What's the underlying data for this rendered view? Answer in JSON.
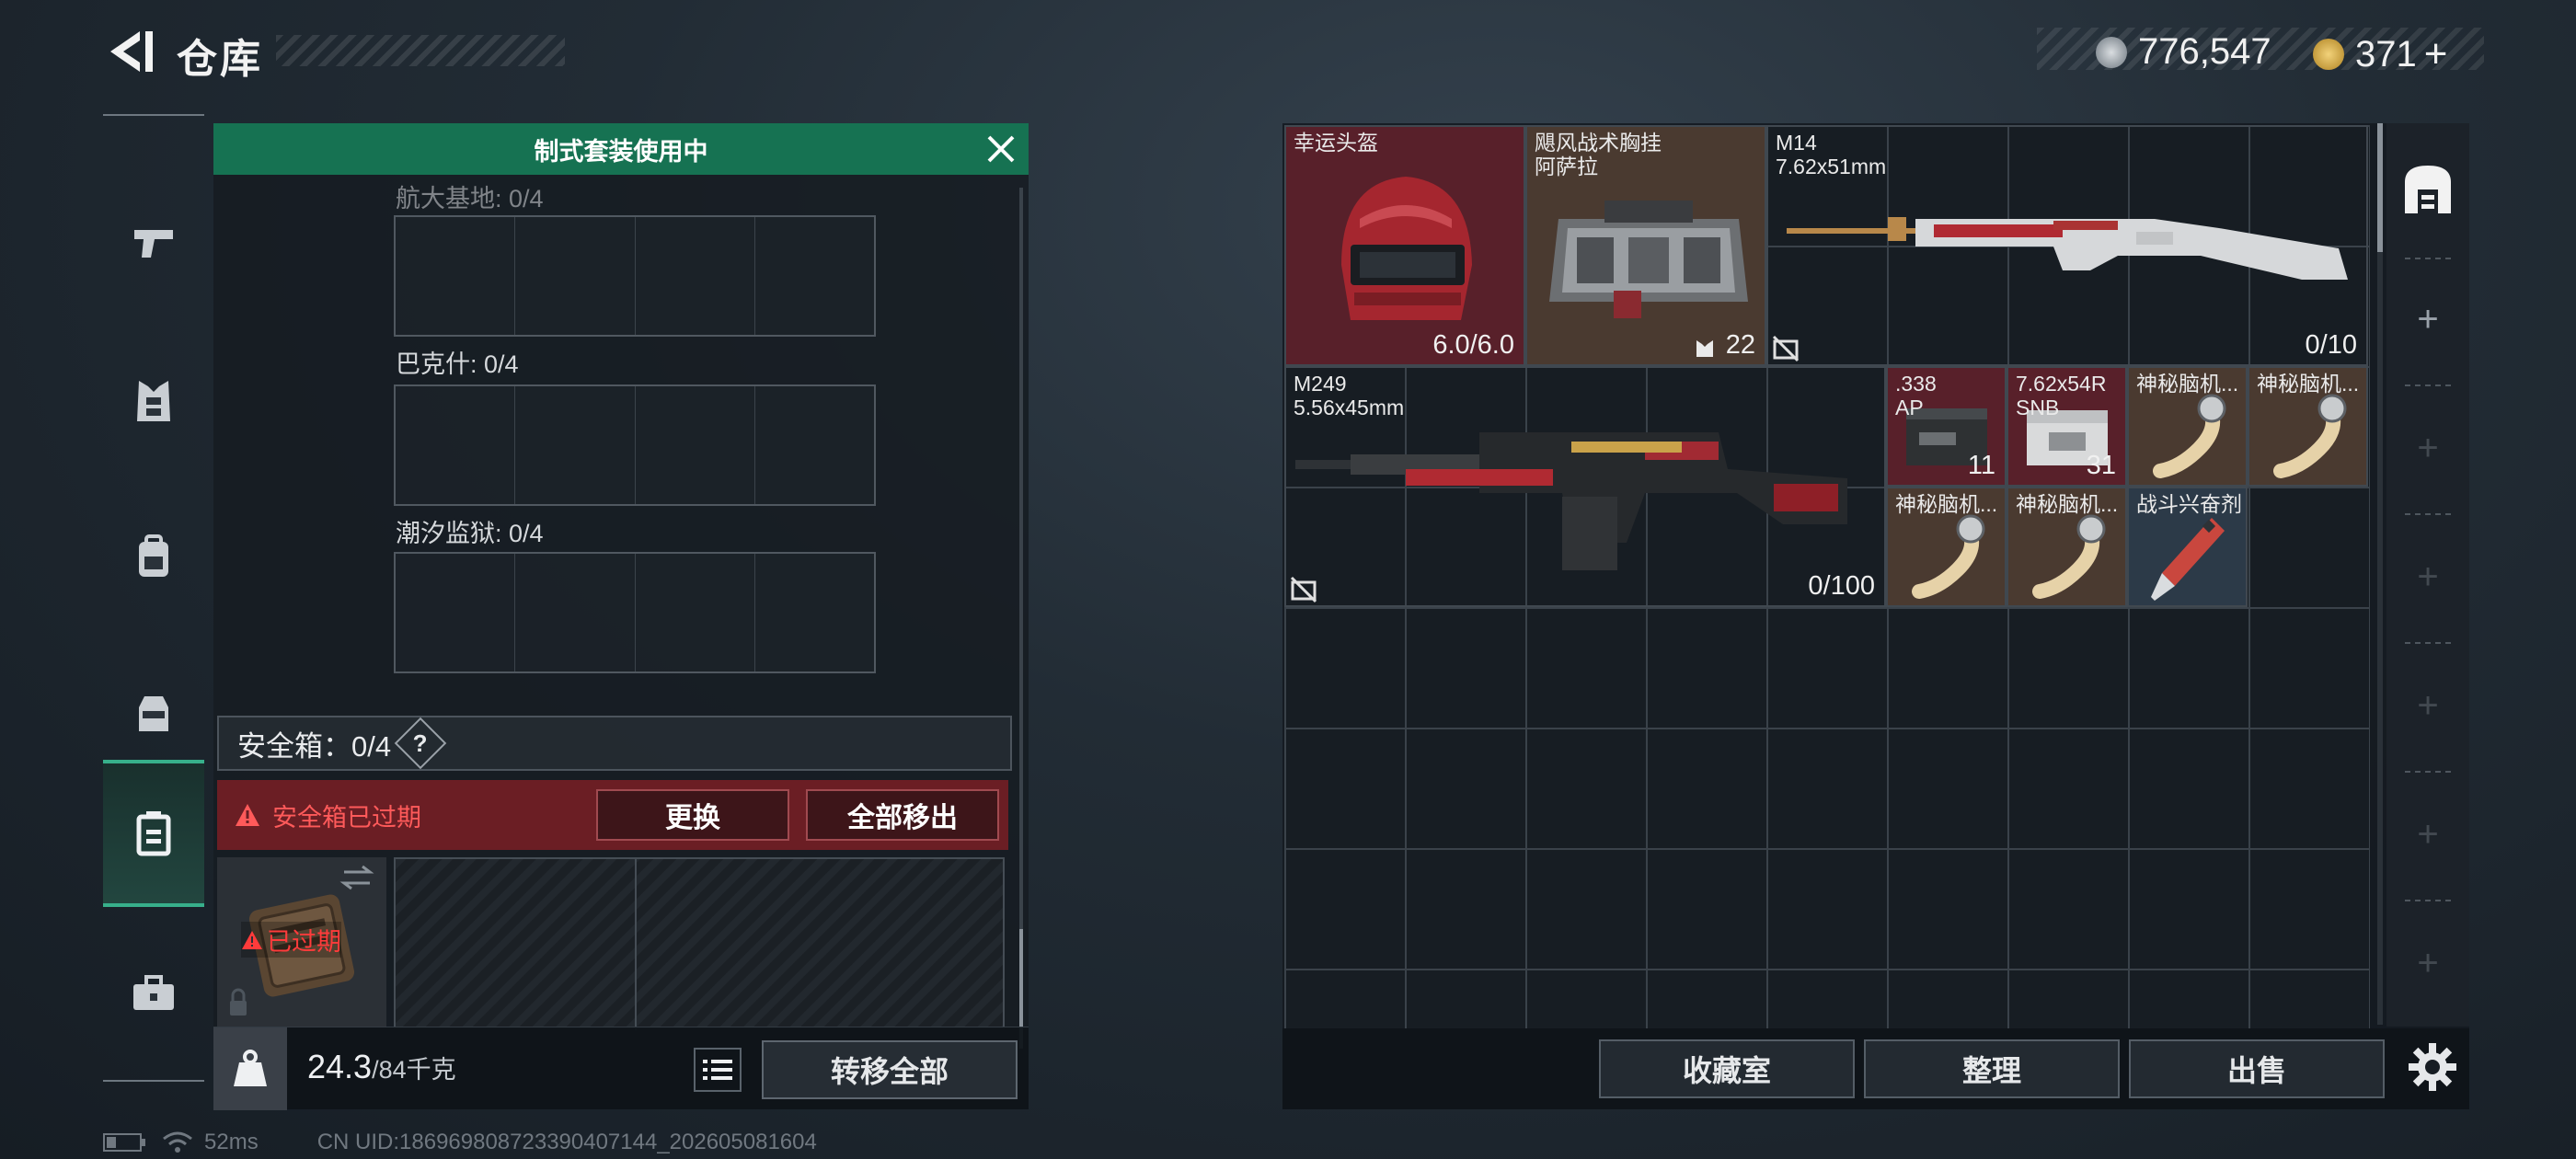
{
  "header": {
    "title": "仓库",
    "coin_amount": "776,547",
    "ticket_amount": "371",
    "ticket_plus": "+"
  },
  "loadout": {
    "banner": "制式套装使用中",
    "maps": [
      {
        "label": "航大基地: 0/4"
      },
      {
        "label": "巴克什: 0/4"
      },
      {
        "label": "潮汐监狱: 0/4"
      }
    ],
    "safe_box_label": "安全箱",
    "safe_box_count": "：0/4",
    "help_glyph": "?",
    "expired_warning": "安全箱已过期",
    "replace_button": "更换",
    "remove_all_button": "全部移出",
    "case_expired_tag": "已过期",
    "weight_current": "24.3",
    "weight_max": "/84千克",
    "transfer_all_button": "转移全部"
  },
  "storage": {
    "items": [
      {
        "name": "幸运头盔",
        "qty": "6.0/6.0"
      },
      {
        "name": "飓风战术胸挂\n阿萨拉",
        "qty": "22"
      },
      {
        "name": "M14\n7.62x51mm",
        "qty": "0/10"
      },
      {
        "name": "M249\n5.56x45mm",
        "qty": "0/100"
      },
      {
        "name": ".338\nAP",
        "qty": "11"
      },
      {
        "name": "7.62x54R\nSNB",
        "qty": "31"
      },
      {
        "name": "神秘脑机...",
        "qty": ""
      },
      {
        "name": "神秘脑机...",
        "qty": ""
      },
      {
        "name": "神秘脑机...",
        "qty": ""
      },
      {
        "name": "神秘脑机...",
        "qty": ""
      },
      {
        "name": "战斗兴奋剂",
        "qty": ""
      }
    ],
    "collection_button": "收藏室",
    "sort_button": "整理",
    "sell_button": "出售",
    "side_plus": "+"
  },
  "status": {
    "ping": "52ms",
    "uid": "CN UID:186969808723390407144_202605081604"
  },
  "colors": {
    "accent_green": "#167252",
    "alert_red": "#ff5a5a",
    "rarity_red": "#58202a",
    "rarity_brown": "#4a3a30"
  },
  "icons": [
    "back-arrow-icon",
    "silver-coin-icon",
    "gold-ticket-icon",
    "pistol-icon",
    "vest-icon",
    "backpack-icon",
    "chest-rig-icon",
    "safe-case-icon",
    "toolbox-icon",
    "close-icon",
    "warning-icon",
    "swap-icon",
    "lock-icon",
    "weight-icon",
    "list-icon",
    "storage-home-icon",
    "gear-icon",
    "no-durability-icon"
  ]
}
